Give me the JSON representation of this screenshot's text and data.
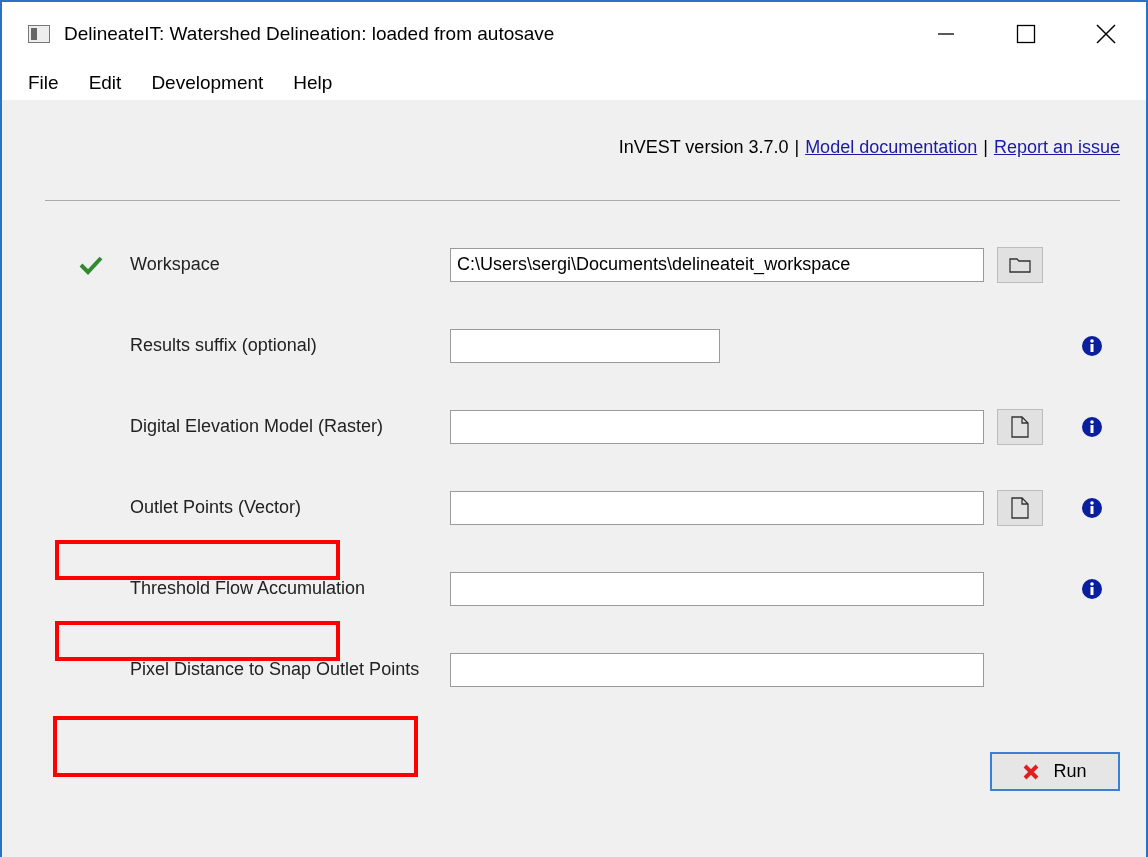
{
  "window": {
    "title": "DelineateIT: Watershed Delineation: loaded from autosave"
  },
  "menu": [
    "File",
    "Edit",
    "Development",
    "Help"
  ],
  "header": [
    {
      "kind": "text",
      "text": "InVEST version 3.7.0"
    },
    {
      "kind": "separator",
      "text": "|"
    },
    {
      "kind": "link",
      "text": "Model documentation"
    },
    {
      "kind": "separator",
      "text": "|"
    },
    {
      "kind": "link",
      "text": "Report an issue"
    }
  ],
  "fields": [
    {
      "label": "Workspace",
      "value": "C:\\Users\\sergi\\Documents\\delineateit_workspace",
      "valid": true,
      "kind": "long",
      "folder_button": true,
      "file_button": false,
      "info": false,
      "highlighted": false
    },
    {
      "label": "Results suffix (optional)",
      "valid": false,
      "kind": "short",
      "folder_button": false,
      "file_button": false,
      "info": true,
      "highlighted": false
    },
    {
      "label": "Digital Elevation Model (Raster)",
      "valid": false,
      "kind": "long",
      "folder_button": false,
      "file_button": true,
      "info": true,
      "highlighted": false
    },
    {
      "label": "Outlet Points (Vector)",
      "valid": false,
      "kind": "long",
      "folder_button": false,
      "file_button": true,
      "info": true,
      "highlighted": false
    },
    {
      "label": "Threshold Flow Accumulation",
      "valid": false,
      "kind": "long",
      "folder_button": false,
      "file_button": false,
      "info": true,
      "highlighted": true
    },
    {
      "label": "Pixel Distance to Snap Outlet Points",
      "valid": false,
      "kind": "long",
      "folder_button": false,
      "file_button": false,
      "info": false,
      "highlighted": true
    }
  ],
  "footer": {
    "highlighted": true,
    "run_button": {
      "label": "Run"
    }
  }
}
